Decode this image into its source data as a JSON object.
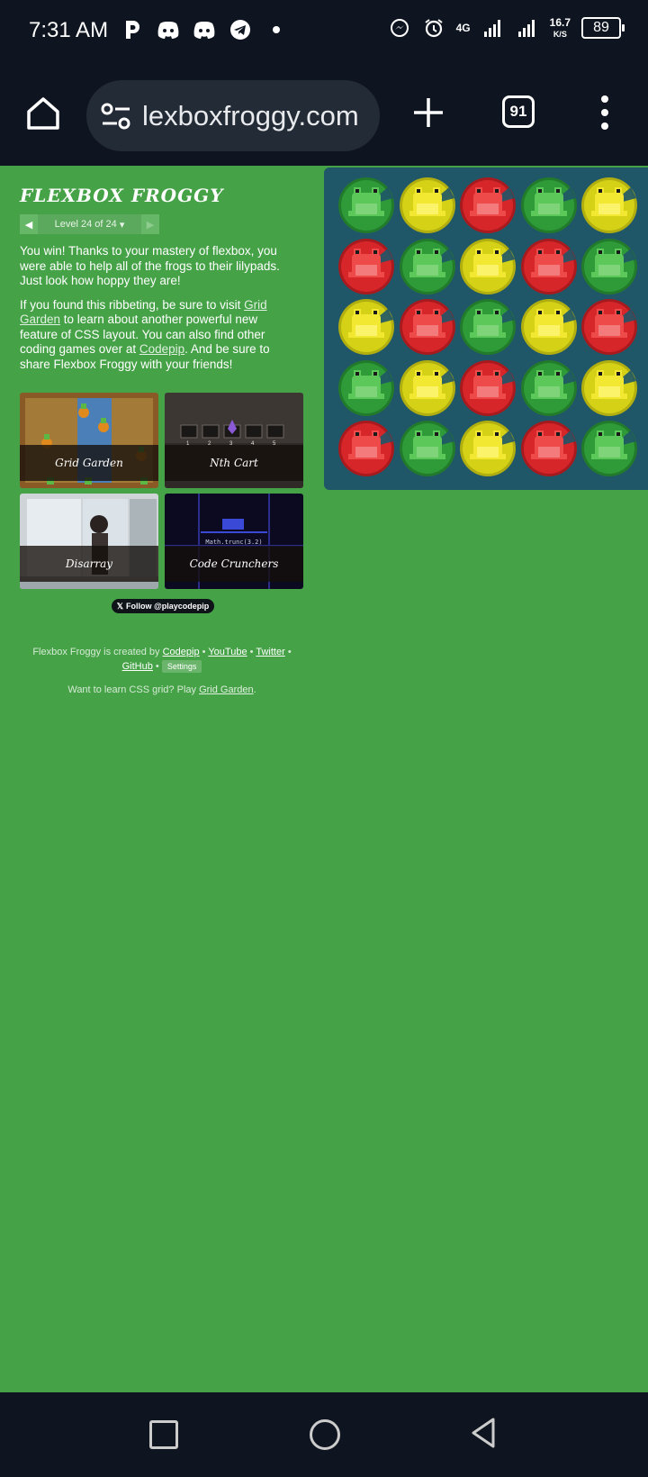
{
  "status_bar": {
    "time": "7:31 AM",
    "network": "4G",
    "speed_value": "16.7",
    "speed_unit": "K/S",
    "battery": "89"
  },
  "browser": {
    "url": "lexboxfroggy.com",
    "tab_count": "91"
  },
  "game": {
    "title": "FLEXBOX FROGGY",
    "level_text": "Level 24 of 24",
    "win_text": "You win! Thanks to your mastery of flexbox, you were able to help all of the frogs to their lilypads. Just look how hoppy they are!",
    "promo_before": "If you found this ribbeting, be sure to visit ",
    "promo_link1": "Grid Garden",
    "promo_middle": " to learn about another powerful new feature of CSS layout. You can also find other coding games over at ",
    "promo_link2": "Codepip",
    "promo_after": ". And be sure to share Flexbox Froggy with your friends!",
    "cards": [
      "Grid Garden",
      "Nth Cart",
      "Disarray",
      "Code Crunchers"
    ],
    "code_text": "Math.trunc(3.2)",
    "follow_label": "Follow @playcodepip",
    "footer_prefix": "Flexbox Froggy is created by ",
    "footer_codepip": "Codepip",
    "footer_youtube": "YouTube",
    "footer_twitter": "Twitter",
    "footer_github": "GitHub",
    "footer_settings": "Settings",
    "footer2_prefix": "Want to learn CSS grid? Play ",
    "footer2_link": "Grid Garden",
    "footer2_suffix": "."
  },
  "pond": {
    "colors": {
      "green": "#2e9b38",
      "yellow": "#d4d117",
      "red": "#d6262a"
    },
    "grid": [
      [
        "green",
        "yellow",
        "red",
        "green",
        "yellow"
      ],
      [
        "red",
        "green",
        "yellow",
        "red",
        "green"
      ],
      [
        "yellow",
        "red",
        "green",
        "yellow",
        "red"
      ],
      [
        "green",
        "yellow",
        "red",
        "green",
        "yellow"
      ],
      [
        "red",
        "green",
        "yellow",
        "red",
        "green"
      ]
    ]
  }
}
